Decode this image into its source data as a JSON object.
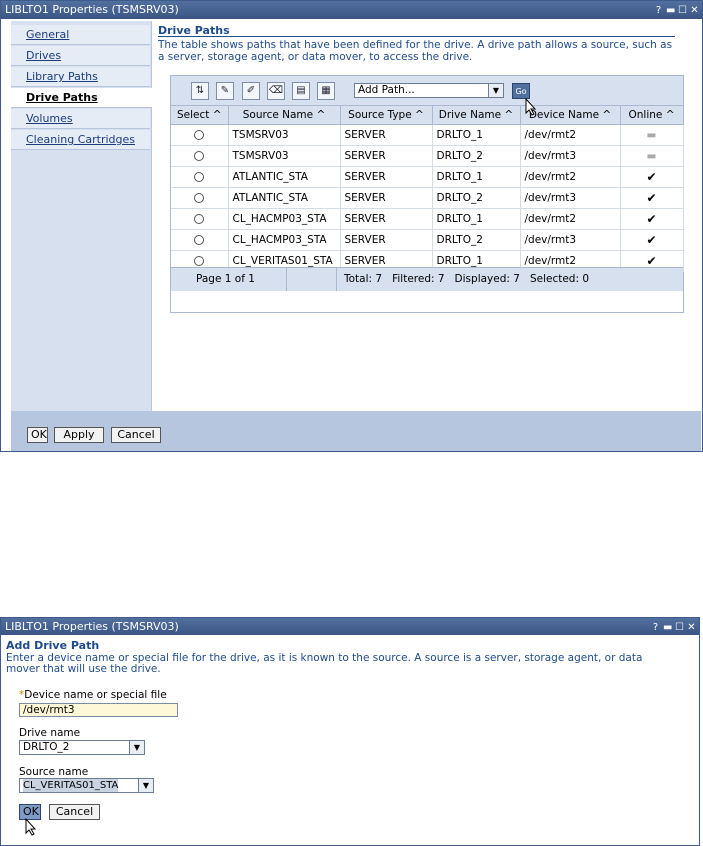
{
  "window1": {
    "title": "LIBLTO1 Properties (TSMSRV03)",
    "sidebar": {
      "items": [
        {
          "label": "General",
          "active": false
        },
        {
          "label": "Drives",
          "active": false
        },
        {
          "label": "Library Paths",
          "active": false
        },
        {
          "label": "Drive Paths",
          "active": true
        },
        {
          "label": "Volumes",
          "active": false
        },
        {
          "label": "Cleaning Cartridges",
          "active": false
        }
      ]
    },
    "section": {
      "title": "Drive Paths",
      "description": "The table shows paths that have been defined for the drive. A drive path allows a source, such as a server, storage agent, or data mover, to access the drive."
    },
    "toolbar": {
      "action_select": "Add Path...",
      "go_label": "Go"
    },
    "table": {
      "columns": [
        "Select",
        "Source Name",
        "Source Type",
        "Drive Name",
        "Device Name",
        "Online"
      ],
      "rows": [
        {
          "source": "TSMSRV03",
          "type": "SERVER",
          "drive": "DRLTO_1",
          "device": "/dev/rmt2",
          "online": false
        },
        {
          "source": "TSMSRV03",
          "type": "SERVER",
          "drive": "DRLTO_2",
          "device": "/dev/rmt3",
          "online": false
        },
        {
          "source": "ATLANTIC_STA",
          "type": "SERVER",
          "drive": "DRLTO_1",
          "device": "/dev/rmt2",
          "online": true
        },
        {
          "source": "ATLANTIC_STA",
          "type": "SERVER",
          "drive": "DRLTO_2",
          "device": "/dev/rmt3",
          "online": true
        },
        {
          "source": "CL_HACMP03_STA",
          "type": "SERVER",
          "drive": "DRLTO_1",
          "device": "/dev/rmt2",
          "online": true
        },
        {
          "source": "CL_HACMP03_STA",
          "type": "SERVER",
          "drive": "DRLTO_2",
          "device": "/dev/rmt3",
          "online": true
        },
        {
          "source": "CL_VERITAS01_STA",
          "type": "SERVER",
          "drive": "DRLTO_1",
          "device": "/dev/rmt2",
          "online": true
        }
      ],
      "footer": {
        "page": "Page 1 of 1",
        "summary": "Total: 7   Filtered: 7   Displayed: 7   Selected: 0"
      }
    },
    "buttons": {
      "ok": "OK",
      "apply": "Apply",
      "cancel": "Cancel"
    }
  },
  "window2": {
    "title": "LIBLTO1 Properties (TSMSRV03)",
    "section": {
      "title": "Add Drive Path",
      "description": "Enter a device name or special file for the drive, as it is known to the source. A source is a server, storage agent, or data mover that will use the drive."
    },
    "fields": {
      "device_label": "Device name or special file",
      "device_required_mark": "*",
      "device_value": "/dev/rmt3",
      "drive_label": "Drive name",
      "drive_value": "DRLTO_2",
      "source_label": "Source name",
      "source_value": "CL_VERITAS01_STA"
    },
    "buttons": {
      "ok": "OK",
      "cancel": "Cancel"
    }
  },
  "colors": {
    "titlebar": "#3e5b8c",
    "sidebar_bg": "#d6e0ee",
    "link": "#1a3c7a",
    "section_text": "#1f4b8a",
    "button_bar": "#b6c6de",
    "required_input_bg": "#fff8d8"
  }
}
